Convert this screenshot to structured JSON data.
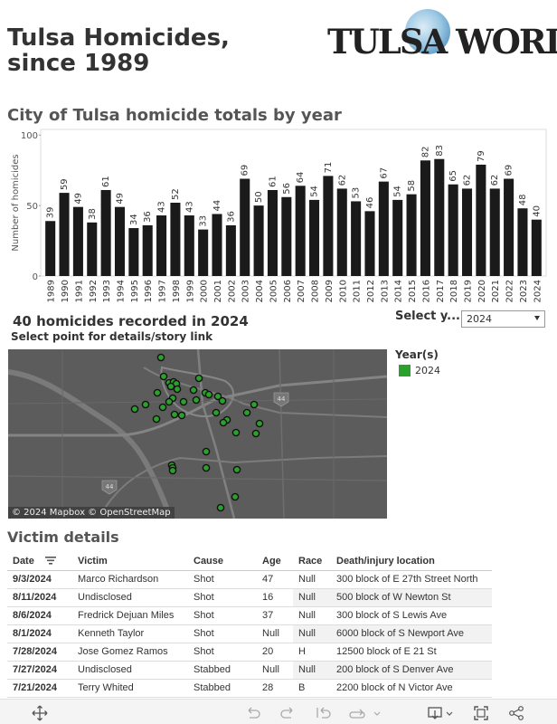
{
  "header": {
    "title_line1": "Tulsa Homicides,",
    "title_line2": "since 1989",
    "logo_text": "TULSA WORLD"
  },
  "chart_section": {
    "title": "City of Tulsa homicide totals by year"
  },
  "chart_data": {
    "type": "bar",
    "title": "City of Tulsa homicide totals by year",
    "xlabel": "",
    "ylabel": "Number of homicides",
    "ylim": [
      0,
      104
    ],
    "yticks": [
      0,
      50,
      100
    ],
    "grid": false,
    "categories": [
      "1989",
      "1990",
      "1991",
      "1992",
      "1993",
      "1994",
      "1995",
      "1996",
      "1997",
      "1998",
      "1999",
      "2000",
      "2001",
      "2002",
      "2003",
      "2004",
      "2005",
      "2006",
      "2007",
      "2008",
      "2009",
      "2010",
      "2011",
      "2012",
      "2013",
      "2014",
      "2015",
      "2016",
      "2017",
      "2018",
      "2019",
      "2020",
      "2021",
      "2022",
      "2023",
      "2024"
    ],
    "values": [
      39,
      59,
      49,
      38,
      61,
      49,
      34,
      36,
      43,
      52,
      43,
      33,
      44,
      36,
      69,
      50,
      61,
      56,
      64,
      54,
      71,
      62,
      53,
      46,
      67,
      54,
      58,
      82,
      83,
      65,
      62,
      79,
      62,
      69,
      48,
      40
    ],
    "bar_color": "#1a1a1a"
  },
  "map_section": {
    "heading": "40 homicides recorded in 2024",
    "subheading": "Select point for details/story link",
    "select_label": "Select y...",
    "select_value": "2024",
    "attribution": "© 2024 Mapbox  © OpenStreetMap",
    "highway_labels": [
      "44",
      "44"
    ],
    "legend_title": "Year(s)",
    "legend_items": [
      {
        "label": "2024",
        "color": "#2ca02c"
      }
    ]
  },
  "victims": {
    "title": "Victim details",
    "columns": [
      "Date",
      "Victim",
      "Cause",
      "Age",
      "Race",
      "Death/injury location"
    ],
    "rows": [
      {
        "date": "9/3/2024",
        "victim": "Marco Richardson",
        "cause": "Shot",
        "age": "47",
        "race": "Null",
        "location": "300 block of E 27th Street North"
      },
      {
        "date": "8/11/2024",
        "victim": "Undisclosed",
        "cause": "Shot",
        "age": "16",
        "race": "Null",
        "location": "500 block of W Newton St"
      },
      {
        "date": "8/6/2024",
        "victim": "Fredrick Dejuan Miles",
        "cause": "Shot",
        "age": "37",
        "race": "Null",
        "location": "300 block of S Lewis Ave"
      },
      {
        "date": "8/1/2024",
        "victim": "Kenneth Taylor",
        "cause": "Shot",
        "age": "Null",
        "race": "Null",
        "location": "6000 block of S Newport Ave"
      },
      {
        "date": "7/28/2024",
        "victim": "Jose Gomez Ramos",
        "cause": "Shot",
        "age": "20",
        "race": "H",
        "location": "12500 block of E 21 St"
      },
      {
        "date": "7/27/2024",
        "victim": "Undisclosed",
        "cause": "Stabbed",
        "age": "Null",
        "race": "Null",
        "location": "200 block of S Denver Ave"
      },
      {
        "date": "7/21/2024",
        "victim": "Terry Whited",
        "cause": "Stabbed",
        "age": "28",
        "race": "B",
        "location": "2200 block of N Victor Ave"
      }
    ]
  },
  "toolbar": {
    "icons": [
      "move-icon",
      "undo-icon",
      "redo-icon",
      "revert-icon",
      "refresh-icon",
      "download-icon",
      "fullscreen-icon",
      "share-icon"
    ]
  }
}
